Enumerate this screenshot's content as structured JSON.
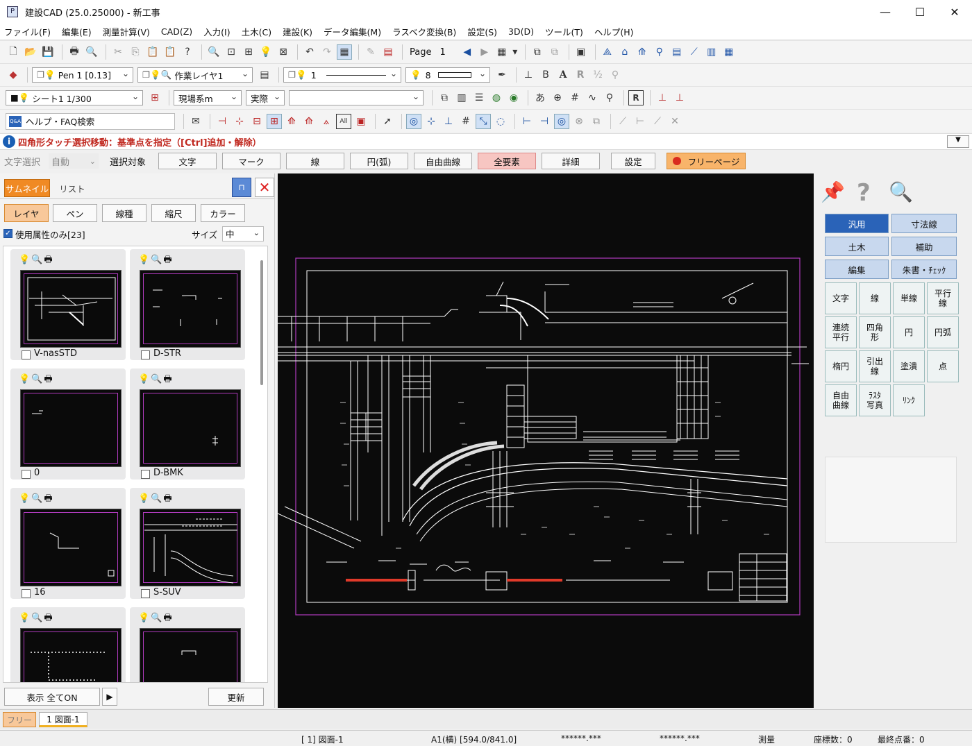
{
  "window": {
    "title": "建設CAD (25.0.25000) - 新工事",
    "minimize": "—",
    "maximize": "☐",
    "close": "✕"
  },
  "menu": [
    "ファイル(F)",
    "編集(E)",
    "測量計算(V)",
    "CAD(Z)",
    "入力(I)",
    "土木(C)",
    "建設(K)",
    "データ編集(M)",
    "ラスベク変換(B)",
    "設定(S)",
    "3D(D)",
    "ツール(T)",
    "ヘルプ(H)"
  ],
  "toolbar1": {
    "page_label": "Page",
    "page_number": "1"
  },
  "toolbar2": {
    "pen": "Pen 1 [0.13]",
    "layer": "作業レイヤ1",
    "line_type_num": "1",
    "color_num": "8"
  },
  "toolbar3": {
    "sheet": "シート1 1/300",
    "coord_system": "現場系m",
    "scale_mode": "実際",
    "extra": ""
  },
  "toolbar4": {
    "help_search": "ヘルプ・FAQ検索"
  },
  "message": {
    "text": "四角形タッチ選択移動：基準点を指定（[Ctrl]追加・解除）"
  },
  "options": {
    "text_select_label": "文字選択",
    "text_select_value": "自動",
    "target_label": "選択対象",
    "buttons": [
      "文字",
      "マーク",
      "線",
      "円(弧)",
      "自由曲線",
      "全要素",
      "詳細"
    ],
    "settings": "設定",
    "free_page": "フリーページ"
  },
  "left_panel": {
    "tabs": [
      "サムネイル",
      "リスト"
    ],
    "filters": [
      "レイヤ",
      "ペン",
      "線種",
      "縮尺",
      "カラー"
    ],
    "used_only": "使用属性のみ[23]",
    "size_label": "サイズ",
    "size_value": "中",
    "thumbnails": [
      "V-nasSTD",
      "D-STR",
      "0",
      "D-BMK",
      "16",
      "S-SUV",
      "",
      ""
    ],
    "show_all_on": "表示 全てON",
    "refresh": "更新"
  },
  "right_panel": {
    "tabs": [
      "汎用",
      "寸法線",
      "土木",
      "補助",
      "編集",
      "朱書・ﾁｪｯｸ"
    ],
    "commands": [
      "文字",
      "線",
      "単線",
      "平行\n線",
      "連続\n平行",
      "四角\n形",
      "円",
      "円弧",
      "楕円",
      "引出\n線",
      "塗潰",
      "点",
      "自由\n曲線",
      "ﾗｽﾀ\n写真",
      "ﾘﾝｸ"
    ]
  },
  "bottom_tabs": {
    "free": "フリー",
    "drawing": "1 図面-1"
  },
  "status": {
    "drawing": "[ 1] 図面-1",
    "paper": "A1(横) [594.0/841.0]",
    "coord_x": "******.***",
    "coord_y": "******.***",
    "survey": "測量",
    "coord_count": "座標数：0",
    "last_point": "最終点番：0"
  },
  "colors": {
    "accent_orange": "#f08a24",
    "highlight_pink": "#f7c6c2",
    "tab_blue": "#2a63b8",
    "canvas_bg": "#0b0b0b",
    "frame_purple": "#b13bbf"
  }
}
